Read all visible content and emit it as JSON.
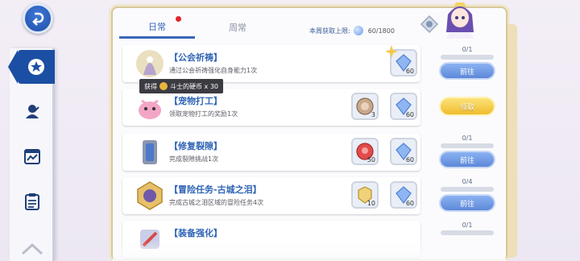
{
  "nav": {
    "items": [
      {
        "name": "nav-item-missions",
        "icon": "star-icon"
      },
      {
        "name": "nav-item-character",
        "icon": "character-icon"
      },
      {
        "name": "nav-item-stats",
        "icon": "chart-icon"
      },
      {
        "name": "nav-item-list",
        "icon": "clipboard-icon"
      }
    ]
  },
  "tabs": {
    "daily": "日常",
    "weekly": "周常"
  },
  "weekly_limit": {
    "label": "本周获取上限:",
    "count": "60/1800"
  },
  "tooltip": {
    "prefix": "获得",
    "item": "斗士的硬币 x 30"
  },
  "tasks": [
    {
      "title": "【公会祈祷】",
      "desc": "通过公会祈祷强化自身能力1次",
      "rewards": [
        {
          "icon": "crystal-icon",
          "qty": "60"
        }
      ],
      "progress": "0/1",
      "progress_value": 0,
      "action": "前往"
    },
    {
      "title": "【宠物打工】",
      "desc": "领取宠物打工的奖励1次",
      "rewards": [
        {
          "icon": "coin-icon",
          "qty": "3"
        },
        {
          "icon": "crystal-icon",
          "qty": "60"
        }
      ],
      "progress": "",
      "progress_value": 1,
      "action": "领取"
    },
    {
      "title": "【修复裂隙】",
      "desc": "完成裂隙挑战1次",
      "rewards": [
        {
          "icon": "red-token-icon",
          "qty": "50"
        },
        {
          "icon": "crystal-icon",
          "qty": "60"
        }
      ],
      "progress": "0/1",
      "progress_value": 0,
      "action": "前往"
    },
    {
      "title": "【冒险任务-古城之泪】",
      "desc": "完成古城之泪区域的冒险任务4次",
      "rewards": [
        {
          "icon": "gold-badge-icon",
          "qty": "10"
        },
        {
          "icon": "crystal-icon",
          "qty": "60"
        }
      ],
      "progress": "0/4",
      "progress_value": 0,
      "action": "前往"
    },
    {
      "title": "【装备强化】",
      "desc": "",
      "rewards": [],
      "progress": "0/1",
      "progress_value": 0,
      "action": ""
    }
  ],
  "colors": {
    "accent": "#3a66b7",
    "nav_active": "#1b4fa3",
    "go_button": "#6b94de",
    "claim_button": "#f1c33a",
    "tab_dot": "#e3262b"
  }
}
